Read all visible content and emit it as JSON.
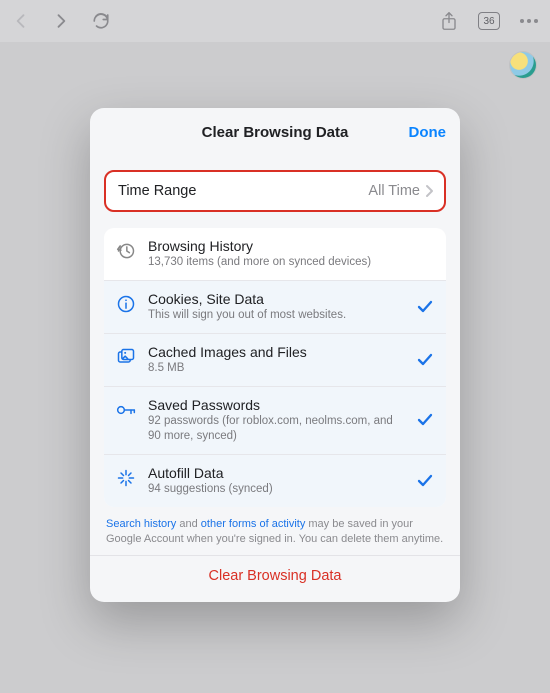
{
  "toolbar": {
    "tab_count": "36"
  },
  "modal": {
    "title": "Clear Browsing Data",
    "done": "Done",
    "range": {
      "label": "Time Range",
      "value": "All Time"
    },
    "options": [
      {
        "title": "Browsing History",
        "subtitle": "13,730 items (and more on synced devices)",
        "selected": false
      },
      {
        "title": "Cookies, Site Data",
        "subtitle": "This will sign you out of most websites.",
        "selected": true
      },
      {
        "title": "Cached Images and Files",
        "subtitle": "8.5 MB",
        "selected": true
      },
      {
        "title": "Saved Passwords",
        "subtitle": "92 passwords (for roblox.com, neolms.com, and 90 more, synced)",
        "selected": true
      },
      {
        "title": "Autofill Data",
        "subtitle": "94 suggestions (synced)",
        "selected": true
      }
    ],
    "footnote": {
      "t1": "Search history",
      "t2": " and ",
      "t3": "other forms of activity",
      "t4": " may be saved in your Google Account when you're signed in. You can delete them anytime."
    },
    "clear": "Clear Browsing Data"
  }
}
